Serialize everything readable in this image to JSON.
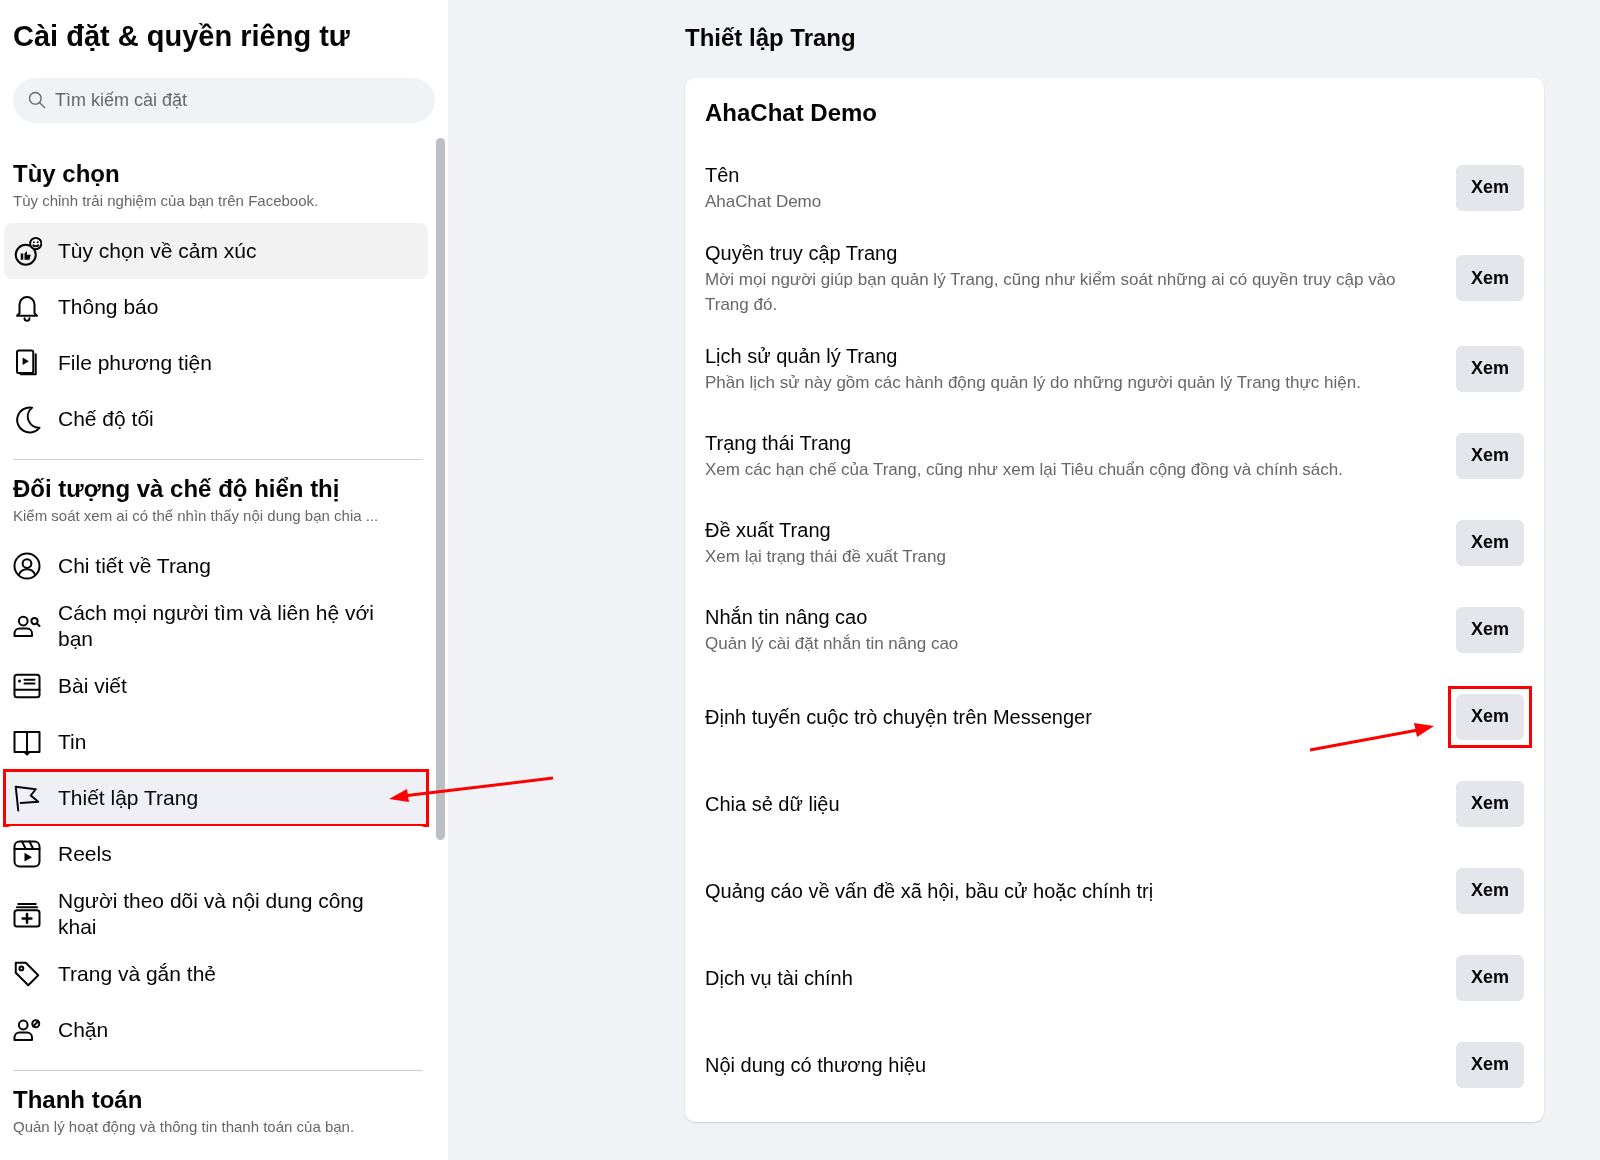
{
  "sidebar": {
    "title": "Cài đặt & quyền riêng tư",
    "search": {
      "placeholder": "Tìm kiếm cài đặt"
    },
    "sections": [
      {
        "heading": "Tùy chọn",
        "subtitle": "Tùy chỉnh trải nghiệm của bạn trên Facebook.",
        "items": [
          {
            "label": "Tùy chọn về cảm xúc",
            "selected": false,
            "hovered": true,
            "annotated": false
          },
          {
            "label": "Thông báo",
            "selected": false,
            "hovered": false,
            "annotated": false
          },
          {
            "label": "File phương tiện",
            "selected": false,
            "hovered": false,
            "annotated": false
          },
          {
            "label": "Chế độ tối",
            "selected": false,
            "hovered": false,
            "annotated": false
          }
        ]
      },
      {
        "heading": "Đối tượng và chế độ hiển thị",
        "subtitle": "Kiểm soát xem ai có thể nhìn thấy nội dung bạn chia ...",
        "items": [
          {
            "label": "Chi tiết về Trang",
            "selected": false,
            "hovered": false,
            "annotated": false
          },
          {
            "label": "Cách mọi người tìm và liên hệ với bạn",
            "selected": false,
            "hovered": false,
            "annotated": false
          },
          {
            "label": "Bài viết",
            "selected": false,
            "hovered": false,
            "annotated": false
          },
          {
            "label": "Tin",
            "selected": false,
            "hovered": false,
            "annotated": false
          },
          {
            "label": "Thiết lập Trang",
            "selected": true,
            "hovered": false,
            "annotated": true
          },
          {
            "label": "Reels",
            "selected": false,
            "hovered": false,
            "annotated": false
          },
          {
            "label": "Người theo dõi và nội dung công khai",
            "selected": false,
            "hovered": false,
            "annotated": false
          },
          {
            "label": "Trang và gắn thẻ",
            "selected": false,
            "hovered": false,
            "annotated": false
          },
          {
            "label": "Chặn",
            "selected": false,
            "hovered": false,
            "annotated": false
          }
        ]
      },
      {
        "heading": "Thanh toán",
        "subtitle": "Quản lý hoạt động và thông tin thanh toán của bạn."
      }
    ]
  },
  "main": {
    "title": "Thiết lập Trang",
    "card": {
      "heading": "AhaChat Demo",
      "rows": [
        {
          "title": "Tên",
          "description": "AhaChat Demo",
          "button": "Xem",
          "annotated": false
        },
        {
          "title": "Quyền truy cập Trang",
          "description": "Mời mọi người giúp bạn quản lý Trang, cũng như kiểm soát những ai có quyền truy cập vào Trang đó.",
          "button": "Xem",
          "annotated": false
        },
        {
          "title": "Lịch sử quản lý Trang",
          "description": "Phần lịch sử này gồm các hành động quản lý do những người quản lý Trang thực hiện.",
          "button": "Xem",
          "annotated": false
        },
        {
          "title": "Trạng thái Trang",
          "description": "Xem các hạn chế của Trang, cũng như xem lại Tiêu chuẩn cộng đồng và chính sách.",
          "button": "Xem",
          "annotated": false
        },
        {
          "title": "Đề xuất Trang",
          "description": "Xem lại trạng thái đề xuất Trang",
          "button": "Xem",
          "annotated": false
        },
        {
          "title": "Nhắn tin nâng cao",
          "description": "Quản lý cài đặt nhắn tin nâng cao",
          "button": "Xem",
          "annotated": false
        },
        {
          "title": "Định tuyến cuộc trò chuyện trên Messenger",
          "button": "Xem",
          "annotated": true
        },
        {
          "title": "Chia sẻ dữ liệu",
          "button": "Xem",
          "annotated": false
        },
        {
          "title": "Quảng cáo về vấn đề xã hội, bầu cử hoặc chính trị",
          "button": "Xem",
          "annotated": false
        },
        {
          "title": "Dịch vụ tài chính",
          "button": "Xem",
          "annotated": false
        },
        {
          "title": "Nội dung có thương hiệu",
          "button": "Xem",
          "annotated": false
        }
      ]
    }
  }
}
